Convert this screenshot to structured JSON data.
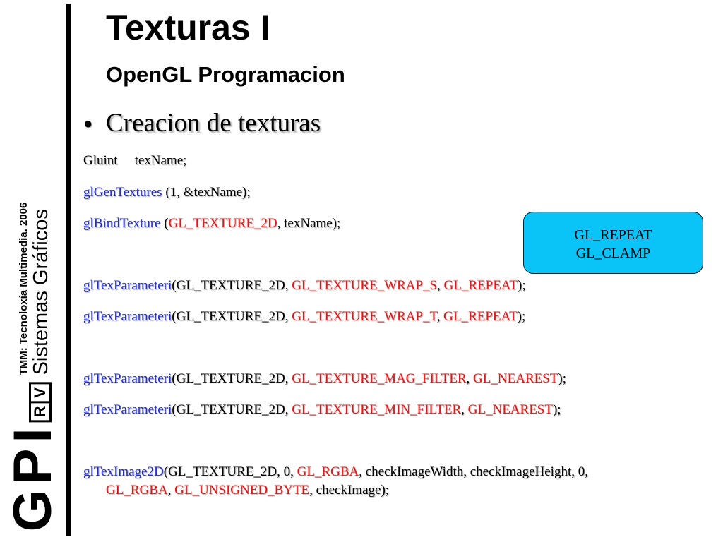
{
  "sidebar": {
    "gpi": "GPI",
    "rv_r": "R",
    "rv_v": "V",
    "tmm": "TMM: Tecnoloxía Multimedia. 2006",
    "sistemas": "Sistemas Gráficos"
  },
  "slide": {
    "title": "Texturas I",
    "subtitle": "OpenGL Programacion",
    "bullet": "Creacion de texturas"
  },
  "code": {
    "l1": {
      "type": "Gluint",
      "var": "texName;"
    },
    "l2": {
      "fn": "glGenTextures",
      "args": " (1, &texName);"
    },
    "l3": {
      "fn": "glBindTexture",
      "open": " (",
      "k1": "GL_TEXTURE_2D",
      "rest": ", texName);"
    },
    "l4": {
      "fn": "glTexParameteri",
      "a": "(GL_TEXTURE_2D, ",
      "k1": "GL_TEXTURE_WRAP_S",
      "sep": ", ",
      "k2": "GL_REPEAT",
      "end": ");"
    },
    "l5": {
      "fn": "glTexParameteri",
      "a": "(GL_TEXTURE_2D, ",
      "k1": "GL_TEXTURE_WRAP_T",
      "sep": ", ",
      "k2": "GL_REPEAT",
      "end": ");"
    },
    "l6": {
      "fn": "glTexParameteri",
      "a": "(GL_TEXTURE_2D, ",
      "k1": "GL_TEXTURE_MAG_FILTER",
      "sep": ", ",
      "k2": "GL_NEAREST",
      "end": ");"
    },
    "l7": {
      "fn": "glTexParameteri",
      "a": "(GL_TEXTURE_2D, ",
      "k1": "GL_TEXTURE_MIN_FILTER",
      "sep": ", ",
      "k2": "GL_NEAREST",
      "end": ");"
    },
    "l8": {
      "fn": "glTexImage2D",
      "a": "(GL_TEXTURE_2D, 0, ",
      "k1": "GL_RGBA",
      "b": ", checkImageWidth, checkImageHeight, 0,"
    },
    "l9": {
      "k1": "GL_RGBA",
      "sep": ", ",
      "k2": "GL_UNSIGNED_BYTE",
      "end": ", checkImage);"
    }
  },
  "callout": {
    "line1": "GL_REPEAT",
    "line2": "GL_CLAMP"
  },
  "colors": {
    "function": "#1f2bd6",
    "constant": "#ee1111",
    "callout_bg": "#0ac3f7"
  }
}
